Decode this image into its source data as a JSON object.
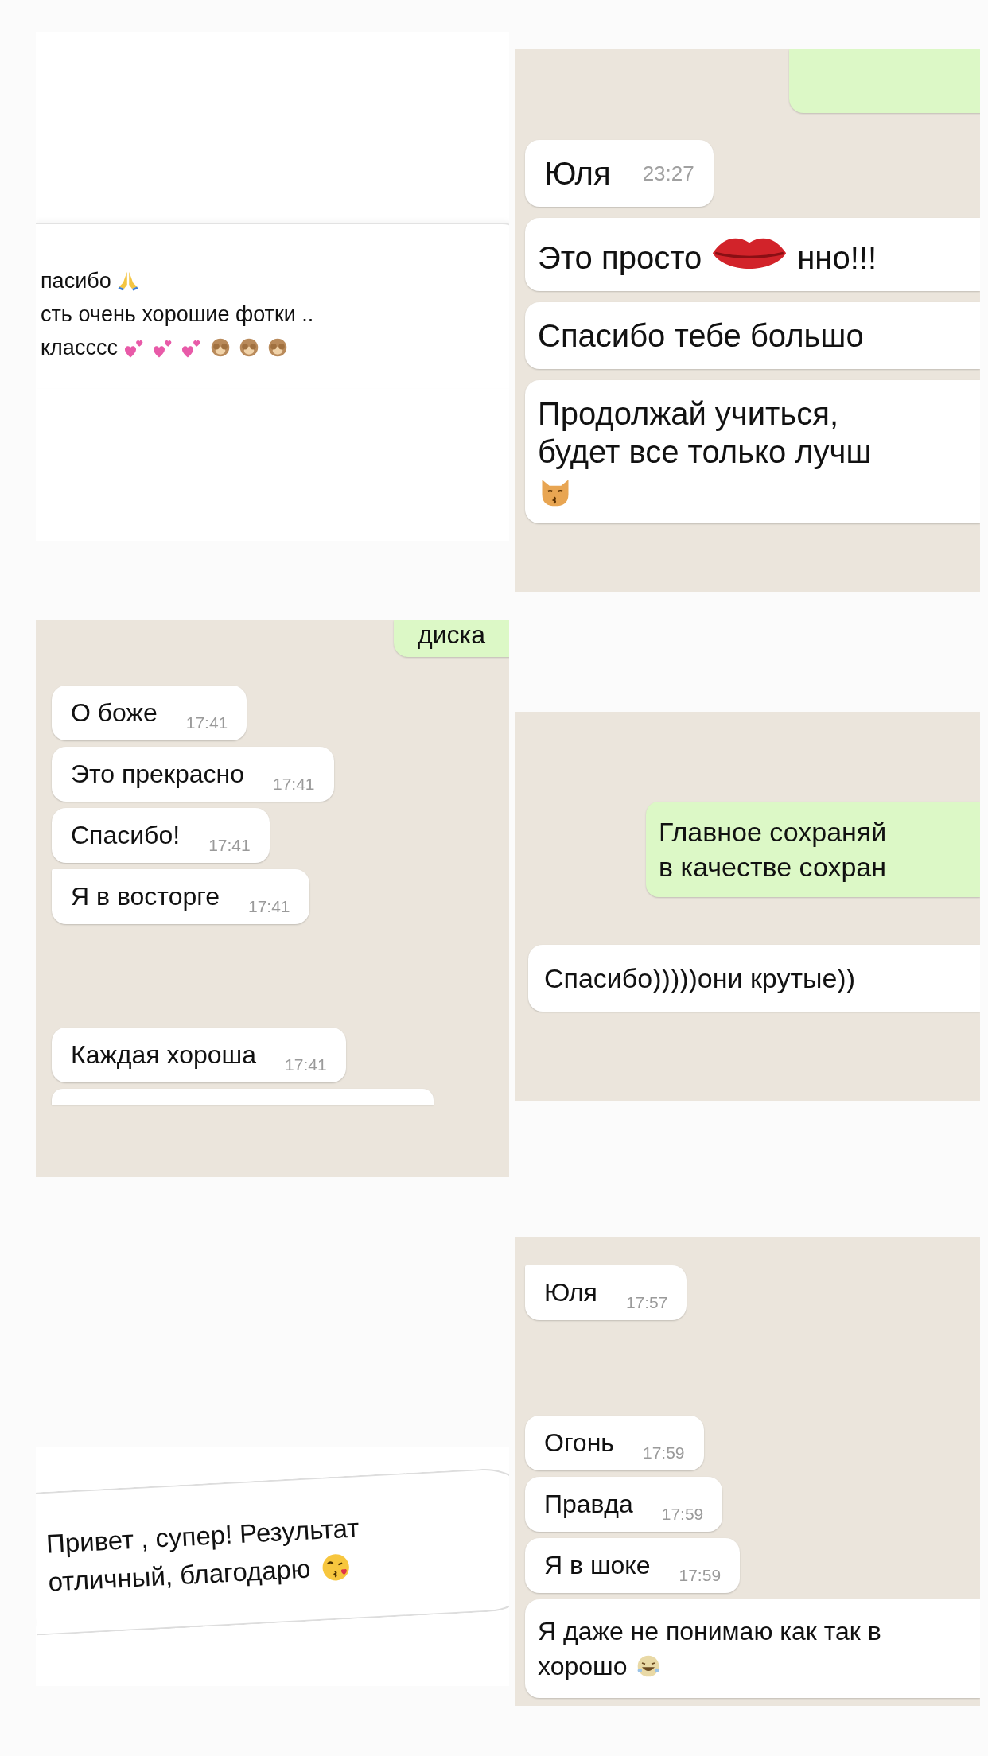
{
  "card_top_left": {
    "lines": [
      "пасибо",
      "сть очень хорошие фотки ..",
      "класссс"
    ]
  },
  "chat_top_right": {
    "header": {
      "text": "Юля",
      "time": "23:27"
    },
    "kiss_message": {
      "before": "Это просто",
      "after": "нно!!!"
    },
    "long_messages": [
      {
        "lines": [
          "Спасибо тебе большо"
        ]
      },
      {
        "lines": [
          "Продолжай учиться,",
          "будет все только лучш"
        ]
      }
    ]
  },
  "chat_middle_left": {
    "sent": "диска",
    "messages": [
      {
        "text": "О боже",
        "time": "17:41"
      },
      {
        "text": "Это прекрасно",
        "time": "17:41"
      },
      {
        "text": "Спасибо!",
        "time": "17:41"
      },
      {
        "text": "Я в восторге",
        "time": "17:41"
      }
    ],
    "later_messages": [
      {
        "text": "Каждая хороша",
        "time": "17:41"
      }
    ]
  },
  "chat_middle_right": {
    "sent_lines": [
      "Главное сохраняй",
      "в качестве сохран"
    ],
    "received": "Спасибо)))))они крутые))"
  },
  "card_bottom_left": {
    "lines": [
      "Привет , супер! Результат",
      "отличный, благодарю"
    ]
  },
  "chat_bottom_right": {
    "messages": [
      {
        "text": "Юля",
        "time": "17:57"
      }
    ],
    "later_messages": [
      {
        "text": "Огонь",
        "time": "17:59"
      },
      {
        "text": "Правда",
        "time": "17:59"
      },
      {
        "text": "Я в шоке",
        "time": "17:59"
      }
    ],
    "long_message": {
      "lines": [
        "Я даже не понимаю как так в",
        "хорошо"
      ]
    }
  }
}
